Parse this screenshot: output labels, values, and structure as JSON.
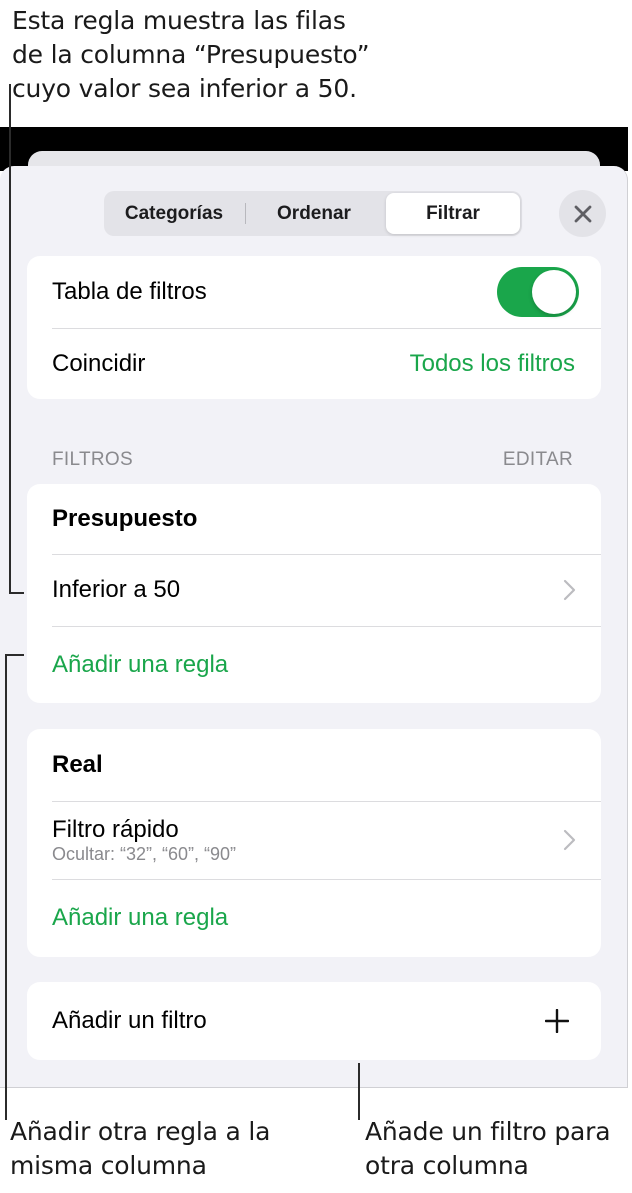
{
  "annotations": {
    "top": [
      "Esta regla muestra las filas",
      "de la columna “Presupuesto”",
      "cuyo valor sea inferior a 50."
    ],
    "bottom_left": [
      "Añadir otra regla a la",
      "misma columna"
    ],
    "bottom_right": [
      "Añade un filtro para",
      "otra columna"
    ]
  },
  "tabs": {
    "items": [
      "Categorías",
      "Ordenar",
      "Filtrar"
    ],
    "selected": "Filtrar"
  },
  "settings": {
    "filter_table_label": "Tabla de filtros",
    "filter_table_on": true,
    "match_label": "Coincidir",
    "match_value": "Todos los filtros"
  },
  "filters_section": {
    "header": "FILTROS",
    "edit": "EDITAR"
  },
  "filter_groups": [
    {
      "column": "Presupuesto",
      "rule": "Inferior a 50",
      "add_rule": "Añadir una regla"
    },
    {
      "column": "Real",
      "rule": "Filtro rápido",
      "rule_detail": "Ocultar: “32”, “60”, “90”",
      "add_rule": "Añadir una regla"
    }
  ],
  "add_filter_label": "Añadir un filtro",
  "colors": {
    "accent": "#1aa64b",
    "sheet_background": "#f2f2f7",
    "secondary_text": "#8a8a8e"
  }
}
